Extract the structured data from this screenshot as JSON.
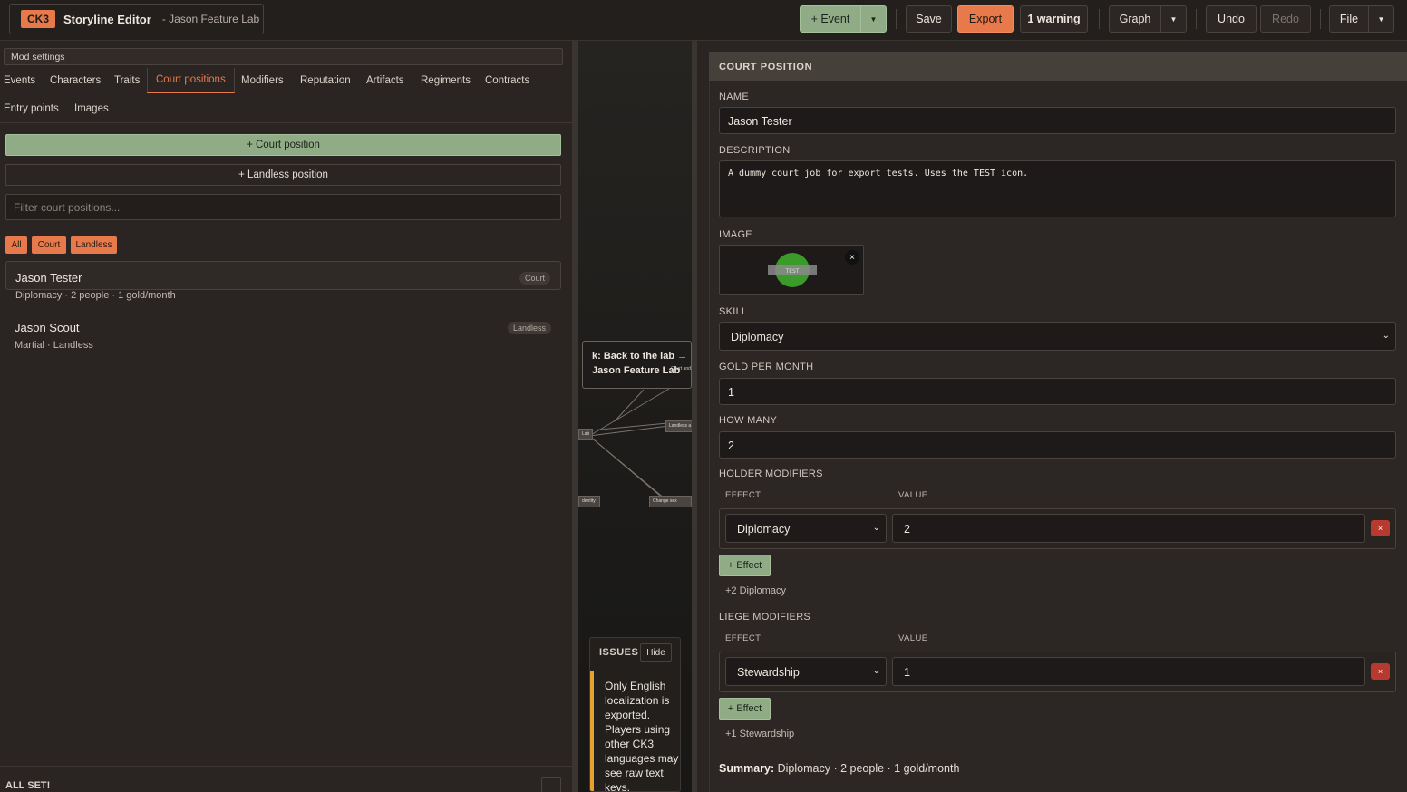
{
  "header": {
    "badge": "CK3",
    "app_title": "Storyline Editor",
    "project": "- Jason Feature Lab",
    "add_event": "+ Event",
    "save": "Save",
    "export": "Export",
    "warning": "1 warning",
    "graph": "Graph",
    "undo": "Undo",
    "redo": "Redo",
    "file": "File"
  },
  "left": {
    "mod_settings": "Mod settings",
    "tabs_row1": [
      "Events",
      "Characters",
      "Traits",
      "Court positions",
      "Modifiers",
      "Reputation",
      "Artifacts",
      "Regiments",
      "Contracts"
    ],
    "tabs_row2": [
      "Entry points",
      "Images"
    ],
    "active_tab": "Court positions",
    "add_court": "+ Court position",
    "add_landless": "+ Landless position",
    "filter_placeholder": "Filter court positions...",
    "chips": [
      "All",
      "Court",
      "Landless"
    ],
    "items": [
      {
        "name": "Jason Tester",
        "meta": "Diplomacy · 2 people · 1 gold/month",
        "tag": "Court"
      },
      {
        "name": "Jason Scout",
        "meta": "Martial · Landless",
        "tag": "Landless"
      }
    ],
    "status": "ALL SET!"
  },
  "graph": {
    "node_line1": "k: Back to the lab →",
    "node_line2": "Jason Feature Lab",
    "node_mini": "Court and",
    "small_nodes": [
      "Lab",
      "Landless a",
      "dentity",
      "Change sex"
    ]
  },
  "issues": {
    "title": "ISSUES",
    "hide": "Hide",
    "message": "Only English localization is exported. Players using other CK3 languages may see raw text keys."
  },
  "form": {
    "section_title": "COURT POSITION",
    "name_label": "NAME",
    "name_value": "Jason Tester",
    "desc_label": "DESCRIPTION",
    "desc_value": "A dummy court job for export tests. Uses the TEST icon.",
    "image_label": "IMAGE",
    "image_text": "TEST",
    "skill_label": "SKILL",
    "skill_value": "Diplomacy",
    "gold_label": "GOLD PER MONTH",
    "gold_value": "1",
    "howmany_label": "HOW MANY",
    "howmany_value": "2",
    "holder_label": "HOLDER MODIFIERS",
    "effect_col": "EFFECT",
    "value_col": "VALUE",
    "holder_effect": "Diplomacy",
    "holder_value": "2",
    "add_effect": "+ Effect",
    "holder_note": "+2 Diplomacy",
    "liege_label": "LIEGE MODIFIERS",
    "liege_effect": "Stewardship",
    "liege_value": "1",
    "liege_note": "+1 Stewardship",
    "summary_label": "Summary:",
    "summary_value": "Diplomacy · 2 people · 1 gold/month"
  },
  "colors": {
    "accent": "#e8794a",
    "green": "#8fac86",
    "danger": "#b83a2e",
    "warning_bar": "#e8a030"
  }
}
